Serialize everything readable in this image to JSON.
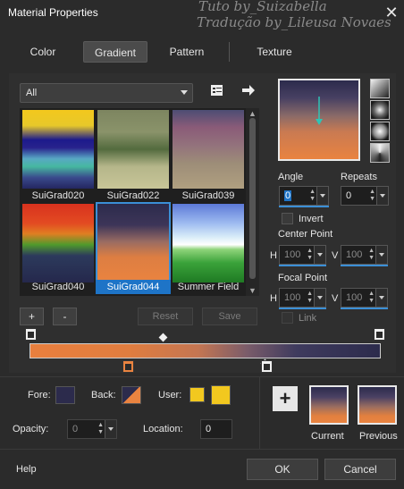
{
  "window": {
    "title": "Material Properties",
    "watermark_line1": "Tuto by_Suizabella",
    "watermark_line2": "Tradução by_Lileusa Novaes"
  },
  "tabs": [
    {
      "label": "Color",
      "active": false
    },
    {
      "label": "Gradient",
      "active": true
    },
    {
      "label": "Pattern",
      "active": false
    },
    {
      "label": "Texture",
      "active": false
    }
  ],
  "library": {
    "category": "All",
    "items": [
      {
        "label": "SuiGrad020",
        "selected": false
      },
      {
        "label": "SuiGrad022",
        "selected": false
      },
      {
        "label": "SuiGrad039",
        "selected": false
      },
      {
        "label": "SuiGrad040",
        "selected": false
      },
      {
        "label": "SuiGrad044",
        "selected": true
      },
      {
        "label": "Summer Field",
        "selected": false
      }
    ],
    "add_label": "+",
    "remove_label": "-",
    "reset_label": "Reset",
    "save_label": "Save"
  },
  "settings": {
    "angle_label": "Angle",
    "angle_value": "0",
    "repeats_label": "Repeats",
    "repeats_value": "0",
    "invert_label": "Invert",
    "center_label": "Center Point",
    "center_h_label": "H",
    "center_h": "100",
    "center_v_label": "V",
    "center_v": "100",
    "focal_label": "Focal Point",
    "focal_h_label": "H",
    "focal_h": "100",
    "focal_v_label": "V",
    "focal_v": "100",
    "link_label": "Link"
  },
  "bottom": {
    "fore_label": "Fore:",
    "back_label": "Back:",
    "user_label": "User:",
    "opacity_label": "Opacity:",
    "opacity_value": "0",
    "location_label": "Location:",
    "location_value": "0",
    "current_label": "Current",
    "previous_label": "Previous",
    "fore_color": "#2c2b4c",
    "user_color": "#f2c81f"
  },
  "footer": {
    "help_label": "Help",
    "ok_label": "OK",
    "cancel_label": "Cancel"
  },
  "colors": {
    "gradient_start": "#e98340",
    "gradient_end": "#2c2b4c",
    "selection": "#1e74c7",
    "accent": "#3b8fd6"
  }
}
